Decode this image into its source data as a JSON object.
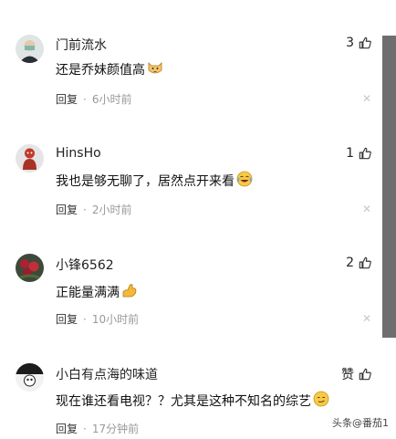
{
  "comments": [
    {
      "username": "门前流水",
      "likes": "3",
      "text": "还是乔妹颜值高",
      "emoji": "cat-face-emoji",
      "reply": "回复",
      "time": "6小时前"
    },
    {
      "username": "HinsHo",
      "likes": "1",
      "text": "我也是够无聊了，居然点开来看",
      "emoji": "tears-of-joy-emoji",
      "reply": "回复",
      "time": "2小时前"
    },
    {
      "username": "小锋6562",
      "likes": "2",
      "text": "正能量满满",
      "emoji": "flexed-biceps-emoji",
      "reply": "回复",
      "time": "10小时前"
    },
    {
      "username": "小白有点海的味道",
      "likes": "赞",
      "text": "现在谁还看电视？？尤其是这种不知名的综艺",
      "emoji": "smirk-emoji",
      "reply": "回复",
      "time": "17分钟前"
    }
  ],
  "watermark": {
    "text": "头条@番茄1"
  },
  "colors": {
    "scrollbar": "#6e6e6e",
    "muted": "#999999"
  }
}
